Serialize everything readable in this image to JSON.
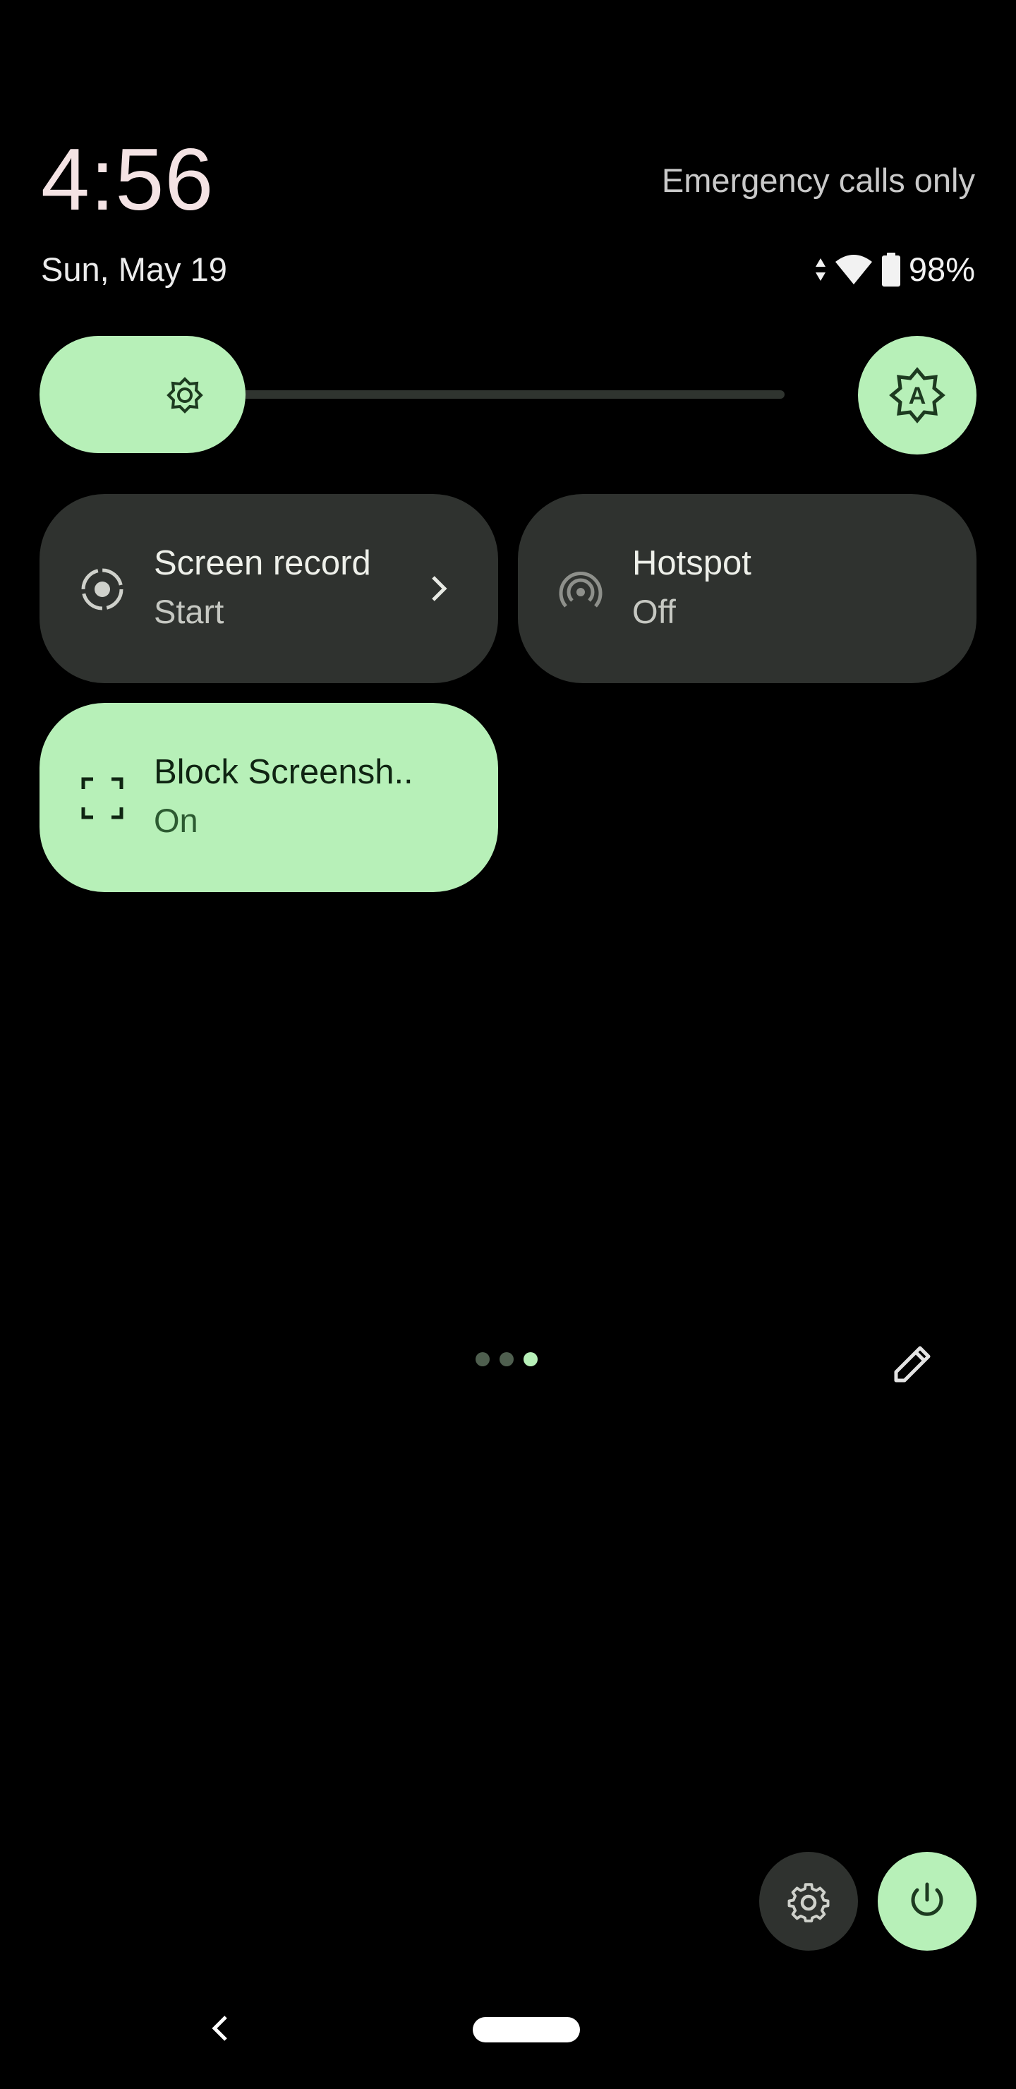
{
  "header": {
    "time": "4:56",
    "carrier_status": "Emergency calls only",
    "date": "Sun, May 19",
    "battery_percent": "98%"
  },
  "brightness": {
    "level": 0.27,
    "icon": "brightness-sun-icon",
    "auto_icon": "auto-brightness-icon"
  },
  "tiles": [
    {
      "label": "Screen record",
      "state": "Start",
      "icon": "screen-record-icon",
      "active": false,
      "has_chevron": true
    },
    {
      "label": "Hotspot",
      "state": "Off",
      "icon": "hotspot-icon",
      "active": false,
      "has_chevron": false
    },
    {
      "label": "Block Screensh..",
      "state": "On",
      "icon": "block-screenshot-icon",
      "active": true,
      "has_chevron": false
    }
  ],
  "pager": {
    "pages": 3,
    "current": 3
  },
  "footer": {
    "settings_icon": "gear-icon",
    "power_icon": "power-icon",
    "edit_icon": "pencil-icon"
  },
  "navbar": {
    "back_icon": "back-chevron-icon",
    "home_icon": "home-pill"
  },
  "colors": {
    "accent": "#b7f0b8",
    "tile_off": "#2f322f",
    "background": "#000000",
    "clock": "#f4e3e4"
  }
}
